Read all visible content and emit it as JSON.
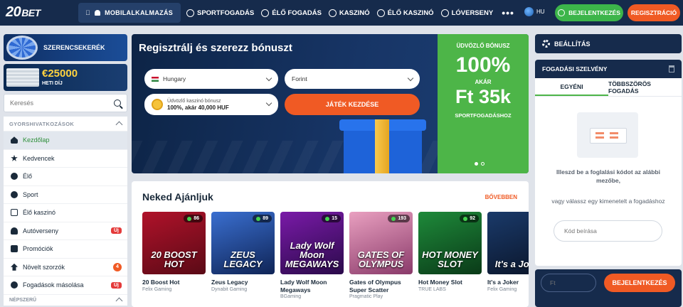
{
  "topbar": {
    "logo_num": "20",
    "logo_text": "BET",
    "mobile_app": "MOBILALKALMAZÁS",
    "nav": [
      {
        "label": "SPORTFOGADÁS",
        "icon": "soccer-ball-icon"
      },
      {
        "label": "ÉLŐ FOGADÁS",
        "icon": "live-ball-icon"
      },
      {
        "label": "KASZINÓ",
        "icon": "casino-chip-icon"
      },
      {
        "label": "ÉLŐ KASZINÓ",
        "icon": "live-casino-icon"
      },
      {
        "label": "LÓVERSENY",
        "icon": "horse-icon"
      }
    ],
    "more": "•••",
    "lang": "HU",
    "login": "BEJELENTKEZÉS",
    "register": "REGISZTRÁCIÓ"
  },
  "sidebar": {
    "wheel_promo": "SZERENCSEKERÉK",
    "cash_amount": "€25000",
    "cash_sub": "HETI DÍJ",
    "search_placeholder": "Keresés",
    "quick_header": "GYORSHIVATKOZÁSOK",
    "items": [
      {
        "label": "Kezdőlap",
        "icon": "home-icon",
        "active": true
      },
      {
        "label": "Kedvencek",
        "icon": "star-icon"
      },
      {
        "label": "Élő",
        "icon": "live-icon"
      },
      {
        "label": "Sport",
        "icon": "soccer-ball-icon"
      },
      {
        "label": "Élő kaszinó",
        "icon": "live-casino-icon"
      },
      {
        "label": "Autóverseny",
        "icon": "helmet-icon",
        "badge": "Új"
      },
      {
        "label": "Promóciók",
        "icon": "gift-icon"
      },
      {
        "label": "Növelt szorzók",
        "icon": "boost-icon",
        "badge": "4"
      },
      {
        "label": "Fogadások másolása",
        "icon": "copy-icon",
        "badge": "Új"
      }
    ],
    "popular_header": "NÉPSZERŰ"
  },
  "banner": {
    "title": "Regisztrálj és szerezz bónuszt",
    "country": "Hungary",
    "currency": "Forint",
    "bonus_line1": "Üdvözlő kaszinó bónusz",
    "bonus_line2": "100%, akár 40,000 HUF",
    "play_button": "JÁTÉK KEZDÉSE",
    "green": {
      "l1": "ÜDVÖZLŐ BÓNUSZ",
      "l2": "100%",
      "l3": "AKÁR",
      "l4": "Ft 35k",
      "l5": "SPORTFOGADÁSHOZ"
    }
  },
  "reco": {
    "title": "Neked Ajánljuk",
    "more": "BŐVEBBEN",
    "games": [
      {
        "name": "20 Boost Hot",
        "provider": "Felix Gaming",
        "count": "86",
        "art": "20 BOOST HOT",
        "color1": "#b0122a",
        "color2": "#5a0a16"
      },
      {
        "name": "Zeus Legacy",
        "provider": "Dynabit Gaming",
        "count": "89",
        "art": "ZEUS LEGACY",
        "color1": "#3a6fd0",
        "color2": "#0f2456"
      },
      {
        "name": "Lady Wolf Moon Megaways",
        "provider": "BGaming",
        "count": "15",
        "art": "Lady Wolf Moon MEGAWAYS",
        "color1": "#7a1aa8",
        "color2": "#2a0a4a"
      },
      {
        "name": "Gates of Olympus Super Scatter",
        "provider": "Pragmatic Play",
        "count": "193",
        "art": "GATES OF OLYMPUS",
        "color1": "#e9a0c0",
        "color2": "#8a3a6a"
      },
      {
        "name": "Hot Money Slot",
        "provider": "TRUE LABS",
        "count": "92",
        "art": "HOT MONEY SLOT",
        "color1": "#1e8a3a",
        "color2": "#0a3a18"
      },
      {
        "name": "It's a Joker",
        "provider": "Felix Gaming",
        "count": "",
        "art": "It's a Joker",
        "color1": "#1a3a6a",
        "color2": "#0a1428"
      }
    ]
  },
  "right": {
    "settings": "BEÁLLÍTÁS",
    "betslip_title": "FOGADÁSI SZELVÉNY",
    "tab_single": "EGYÉNI",
    "tab_multi": "TÖBBSZÖRÖS FOGADÁS",
    "text1": "Illeszd be a foglalási kódot az alábbi mezőbe,",
    "text2": "vagy válassz egy kimenetelt a fogadáshoz",
    "code_placeholder": "Kód beírása",
    "ft_placeholder": "Ft",
    "login_button": "BEJELENTKEZÉS"
  }
}
